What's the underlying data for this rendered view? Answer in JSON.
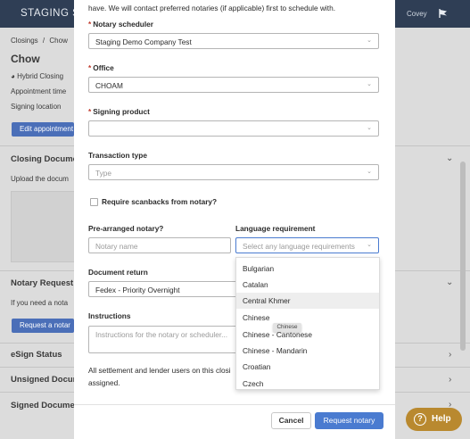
{
  "app": {
    "brand": "STAGING SE",
    "user_partial": "Covey",
    "breadcrumb": {
      "root": "Closings",
      "sep": "/",
      "current": "Chow"
    },
    "title": "Chow",
    "left_items": {
      "hybrid": "Hybrid Closing",
      "appt_time": "Appointment time",
      "signing_location": "Signing location",
      "edit_btn": "Edit appointment",
      "closing_docs": "Closing Docume",
      "upload_text": "Upload the docum",
      "notary_request": "Notary Request",
      "notary_need": "If you need a nota",
      "request_btn": "Request a notar",
      "esign": "eSign Status",
      "unsigned": "Unsigned Docum",
      "signed": "Signed Documen"
    },
    "help_label": "Help"
  },
  "modal": {
    "intro": "have. We will contact preferred notaries (if applicable) first to schedule with.",
    "fields": {
      "scheduler": {
        "label": "Notary scheduler",
        "required": "*",
        "value": "Staging Demo Company Test"
      },
      "office": {
        "label": "Office",
        "required": "*",
        "value": "CHOAM"
      },
      "signing_product": {
        "label": "Signing product",
        "required": "*",
        "value": ""
      },
      "transaction_type": {
        "label": "Transaction type",
        "placeholder": "Type"
      },
      "scanbacks": {
        "label": "Require scanbacks from notary?"
      },
      "prearranged": {
        "label": "Pre-arranged notary?",
        "placeholder": "Notary name"
      },
      "language": {
        "label": "Language requirement",
        "placeholder": "Select any language requirements"
      },
      "document_return": {
        "label": "Document return",
        "value": "Fedex - Priority Overnight"
      },
      "instructions": {
        "label": "Instructions",
        "placeholder": "Instructions for the notary or scheduler..."
      }
    },
    "note_line1": "All settlement and lender users on this closi",
    "note_line2": "assigned.",
    "cancel_label": "Cancel",
    "request_label": "Request notary"
  },
  "language_dropdown": {
    "options": [
      "Bulgarian",
      "Catalan",
      "Central Khmer",
      "Chinese",
      "Chinese - Cantonese",
      "Chinese - Mandarin",
      "Croatian",
      "Czech"
    ],
    "hovered": "Central Khmer",
    "tooltip": "Chinese"
  },
  "colors": {
    "topbar": "#2f3e55",
    "primary": "#4a7bd0",
    "help": "#b9892f",
    "required": "#c0392b"
  }
}
